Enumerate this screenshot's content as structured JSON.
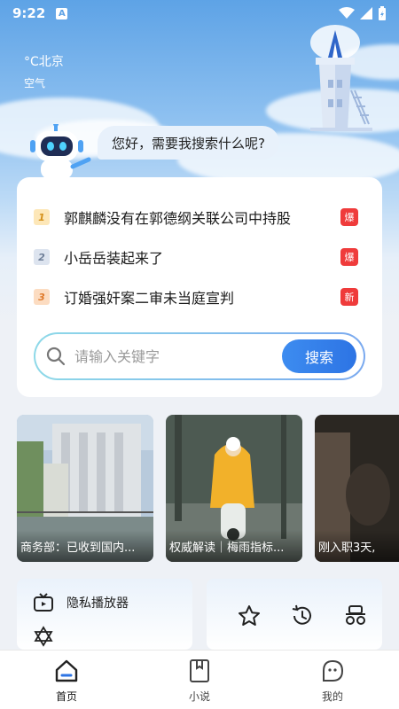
{
  "status_bar": {
    "time": "9:22",
    "indicator": "A"
  },
  "weather": {
    "temp_city": "°C北京",
    "air": "空气"
  },
  "assistant": {
    "greeting": "您好，需要我搜索什么呢?"
  },
  "hot_list": [
    {
      "rank": "1",
      "title": "郭麒麟没有在郭德纲关联公司中持股",
      "badge": "爆",
      "badge_color": "#ef3b3b"
    },
    {
      "rank": "2",
      "title": "小岳岳装起来了",
      "badge": "爆",
      "badge_color": "#ef3b3b"
    },
    {
      "rank": "3",
      "title": "订婚强奸案二审未当庭宣判",
      "badge": "新",
      "badge_color": "#ef3b3b"
    }
  ],
  "search": {
    "placeholder": "请输入关键字",
    "button_label": "搜索"
  },
  "news": [
    {
      "caption": "商务部：已收到国内..."
    },
    {
      "caption": "权威解读｜梅雨指标..."
    },
    {
      "caption": "刚入职3天,"
    }
  ],
  "tools": {
    "private_player": "隐私播放器"
  },
  "bottom_nav": [
    {
      "label": "首页",
      "icon": "home-icon",
      "active": true
    },
    {
      "label": "小说",
      "icon": "book-icon",
      "active": false
    },
    {
      "label": "我的",
      "icon": "profile-icon",
      "active": false
    }
  ],
  "colors": {
    "accent": "#2d74e4",
    "hot_badge": "#ef3b3b"
  }
}
